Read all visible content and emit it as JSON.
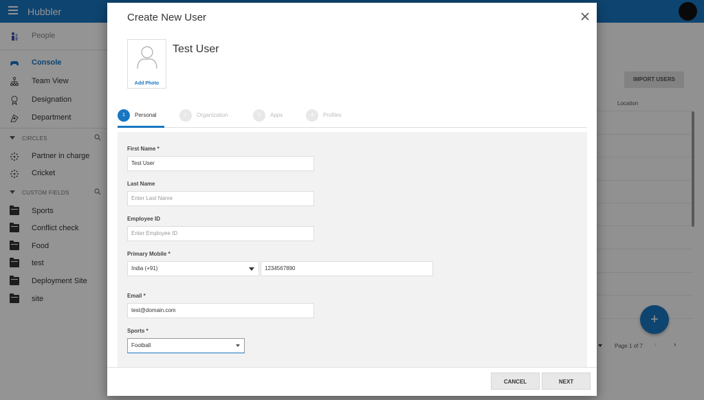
{
  "app": {
    "brand": "Hubbler"
  },
  "sidebar": {
    "items": [
      {
        "label": "People"
      },
      {
        "label": "Console"
      },
      {
        "label": "Team View"
      },
      {
        "label": "Designation"
      },
      {
        "label": "Department"
      }
    ],
    "circles_header": "CIRCLES",
    "circles": [
      {
        "label": "Partner in charge"
      },
      {
        "label": "Cricket"
      }
    ],
    "custom_fields_header": "CUSTOM FIELDS",
    "custom_fields": [
      {
        "label": "Sports"
      },
      {
        "label": "Conflict check"
      },
      {
        "label": "Food"
      },
      {
        "label": "test"
      },
      {
        "label": "Deployment Site"
      },
      {
        "label": "site"
      }
    ]
  },
  "background": {
    "import_label": "IMPORT USERS",
    "column_header": "Location",
    "pager_text": "Page 1 of 7",
    "fab_symbol": "+",
    "prev_symbol": "‹",
    "next_symbol": "›"
  },
  "modal": {
    "title": "Create New User",
    "add_photo_label": "Add Photo",
    "user_name": "Test User",
    "steps": [
      {
        "number": "1",
        "label": "Personal"
      },
      {
        "number": "2",
        "label": "Organization"
      },
      {
        "number": "3",
        "label": "Apps"
      },
      {
        "number": "4",
        "label": "Profiles"
      }
    ],
    "fields": {
      "first_name": {
        "label": "First Name *",
        "value": "Test User"
      },
      "last_name": {
        "label": "Last Name",
        "placeholder": "Enter Last Name"
      },
      "employee_id": {
        "label": "Employee ID",
        "placeholder": "Enter Employee ID"
      },
      "primary_mobile": {
        "label": "Primary Mobile *",
        "country": "India (+91)",
        "number": "1234567890"
      },
      "email": {
        "label": "Email *",
        "value": "test@domain.com"
      },
      "sports": {
        "label": "Sports *",
        "value": "Football"
      }
    },
    "cancel_label": "CANCEL",
    "next_label": "NEXT"
  },
  "colors": {
    "primary": "#1976c2",
    "overlay": "rgba(0,0,0,0.42)"
  }
}
